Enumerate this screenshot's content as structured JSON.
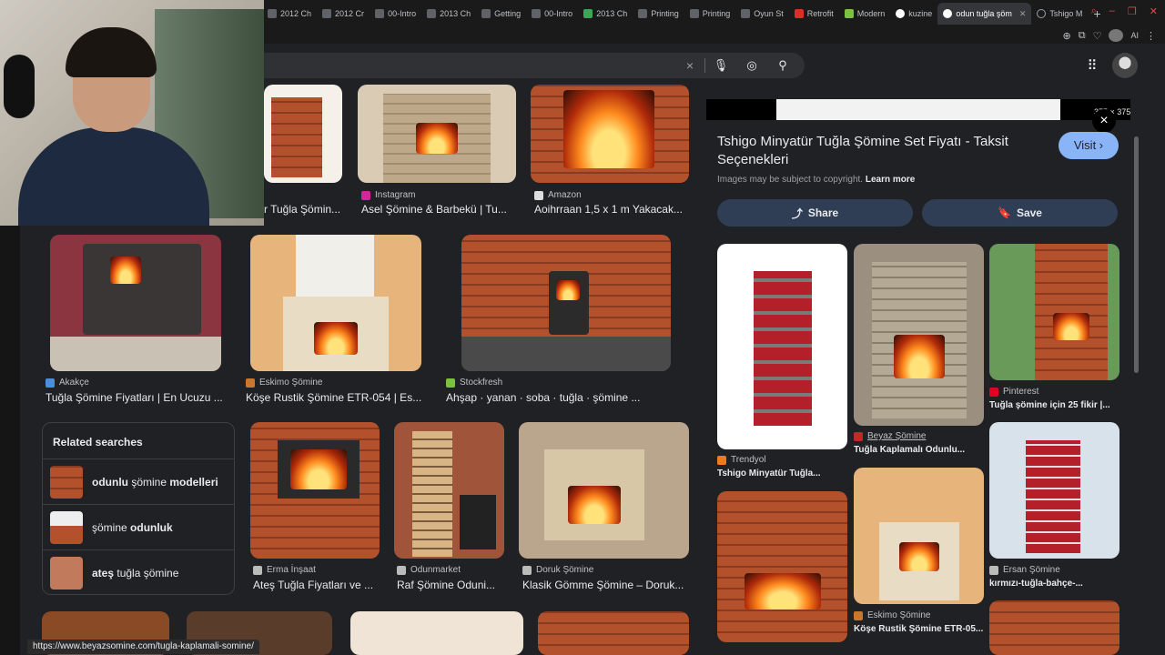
{
  "browser": {
    "tabs": [
      {
        "label": "2012 Ch"
      },
      {
        "label": "2012 Cr"
      },
      {
        "label": "00-Intro"
      },
      {
        "label": "2013 Ch"
      },
      {
        "label": "Getting"
      },
      {
        "label": "00-Intro"
      },
      {
        "label": "2013 Ch"
      },
      {
        "label": "Printing"
      },
      {
        "label": "Printing"
      },
      {
        "label": "Oyun St"
      },
      {
        "label": "Retrofit"
      },
      {
        "label": "Modern"
      },
      {
        "label": "kuzine"
      },
      {
        "label": "odun tuğla şöm"
      },
      {
        "label": "Tshigo M"
      }
    ],
    "active_tab_index": 13,
    "new_tab": "+",
    "toolbar_ai": "AI"
  },
  "search": {
    "clear_icon": "×",
    "mic_icon": "microphone-icon",
    "lens_icon": "lens-icon",
    "search_icon": "search-icon"
  },
  "results": [
    {
      "source": "",
      "title": "r Tuğla Şömin...",
      "favicon_color": "#777777"
    },
    {
      "source": "Instagram",
      "title": "Asel Şömine & Barbekü | Tu...",
      "favicon_color": "#d6249f"
    },
    {
      "source": "Amazon",
      "title": "Aoihrraan 1,5 x 1 m Yakacak...",
      "favicon_color": "#dddddd"
    },
    {
      "source": "Akakçe",
      "title": "Tuğla Şömine Fiyatları | En Ucuzu ...",
      "favicon_color": "#4a90d9"
    },
    {
      "source": "Eskimo Şömine",
      "title": "Köşe Rustik Şömine ETR-054 | Es...",
      "favicon_color": "#c8772f"
    },
    {
      "source": "Stockfresh",
      "title": "Ahşap · yanan · soba · tuğla · şömine ...",
      "favicon_color": "#7cc242"
    },
    {
      "source": "Erma İnşaat",
      "title": "Ateş Tuğla Fiyatları ve ...",
      "favicon_color": "#bbbbbb"
    },
    {
      "source": "Odunmarket",
      "title": "Raf Şömine Oduni...",
      "favicon_color": "#bbbbbb"
    },
    {
      "source": "Doruk Şömine",
      "title": "Klasik Gömme Şömine – Doruk...",
      "favicon_color": "#bbbbbb"
    }
  ],
  "related": {
    "heading": "Related searches",
    "items": [
      {
        "bold": "odunlu",
        "plain": " şömine ",
        "bold2": "modelleri"
      },
      {
        "bold": "",
        "plain": "şömine ",
        "bold2": "odunluk"
      },
      {
        "bold": "ateş",
        "plain": " tuğla şömine",
        "bold2": ""
      }
    ]
  },
  "panel": {
    "dimensions": "375 × 375",
    "close_icon": "×",
    "title": "Tshigo Minyatür Tuğla Şömine Set Fiyatı - Taksit Seçenekleri",
    "visit_label": "Visit",
    "copyright": "Images may be subject to copyright.",
    "learn_more": "Learn more",
    "share_label": "Share",
    "save_label": "Save",
    "related_images": [
      {
        "source": "Trendyol",
        "title": "Tshigo Minyatür Tuğla..."
      },
      {
        "source": "Beyaz Şömine",
        "title": "Tuğla Kaplamalı Odunlu..."
      },
      {
        "source": "Pinterest",
        "title": "Tuğla şömine için 25 fikir |..."
      },
      {
        "source": "Eskimo Şömine",
        "title": "Köşe Rustik Şömine ETR-05..."
      },
      {
        "source": "Ersan Şömine",
        "title": "kırmızı-tuğla-bahçe-..."
      }
    ]
  },
  "status_url": "https://www.beyazsomine.com/tugla-kaplamali-somine/"
}
